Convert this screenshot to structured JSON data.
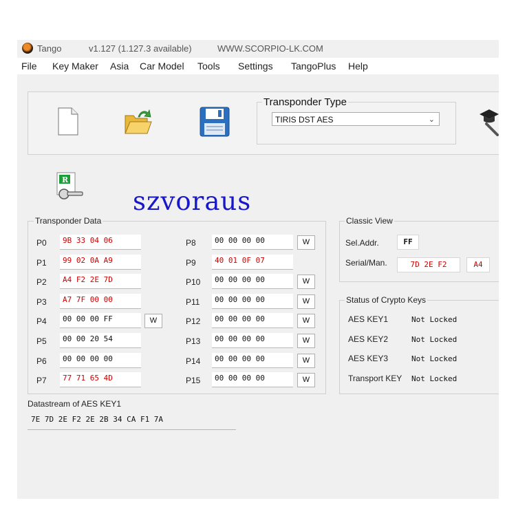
{
  "titlebar": {
    "app_name": "Tango",
    "version": "v1.127 (1.127.3 available)",
    "website": "WWW.SCORPIO-LK.COM"
  },
  "menu": [
    "File",
    "Key Maker",
    "Asia",
    "Car Model",
    "Tools",
    "Settings",
    "TangoPlus",
    "Help"
  ],
  "toolbar": {
    "icons": [
      "new-file-icon",
      "open-folder-icon",
      "save-floppy-icon",
      "graduation-key-icon",
      "read-key-icon"
    ]
  },
  "transponder_type": {
    "label": "Transponder Type",
    "selected": "TIRIS DST AES"
  },
  "watermark": "szvoraus",
  "transponder_data": {
    "label": "Transponder Data",
    "write_label": "W",
    "left": [
      {
        "name": "P0",
        "value": "9B 33 04 06",
        "color": "#cc0000"
      },
      {
        "name": "P1",
        "value": "99 02 0A A9",
        "color": "#cc0000"
      },
      {
        "name": "P2",
        "value": "A4 F2 2E 7D",
        "color": "#cc0000"
      },
      {
        "name": "P3",
        "value": "A7 7F 00 00",
        "color": "#cc0000"
      },
      {
        "name": "P4",
        "value": "00 00 00 FF",
        "color": "#111111"
      },
      {
        "name": "P5",
        "value": "00 00 20 54",
        "color": "#111111"
      },
      {
        "name": "P6",
        "value": "00 00 00 00",
        "color": "#111111"
      },
      {
        "name": "P7",
        "value": "77 71 65 4D",
        "color": "#cc0000"
      }
    ],
    "right": [
      {
        "name": "P8",
        "value": "00 00 00 00",
        "color": "#111111"
      },
      {
        "name": "P9",
        "value": "40 01 0F 07",
        "color": "#cc0000"
      },
      {
        "name": "P10",
        "value": "00 00 00 00",
        "color": "#111111"
      },
      {
        "name": "P11",
        "value": "00 00 00 00",
        "color": "#111111"
      },
      {
        "name": "P12",
        "value": "00 00 00 00",
        "color": "#111111"
      },
      {
        "name": "P13",
        "value": "00 00 00 00",
        "color": "#111111"
      },
      {
        "name": "P14",
        "value": "00 00 00 00",
        "color": "#111111"
      },
      {
        "name": "P15",
        "value": "00 00 00 00",
        "color": "#111111"
      }
    ]
  },
  "classic_view": {
    "label": "Classic View",
    "sel_addr_label": "Sel.Addr.",
    "sel_addr_value": "FF",
    "serial_label": "Serial/Man.",
    "serial_value": "7D 2E F2",
    "man_value": "A4"
  },
  "crypto_keys": {
    "label": "Status of Crypto Keys",
    "items": [
      {
        "name": "AES KEY1",
        "status": "Not Locked"
      },
      {
        "name": "AES KEY2",
        "status": "Not Locked"
      },
      {
        "name": "AES KEY3",
        "status": "Not Locked"
      },
      {
        "name": "Transport KEY",
        "status": "Not Locked"
      }
    ]
  },
  "datastream": {
    "label": "Datastream of AES KEY1",
    "value": "7E 7D 2E F2 2E 2B 34 CA F1 7A"
  }
}
